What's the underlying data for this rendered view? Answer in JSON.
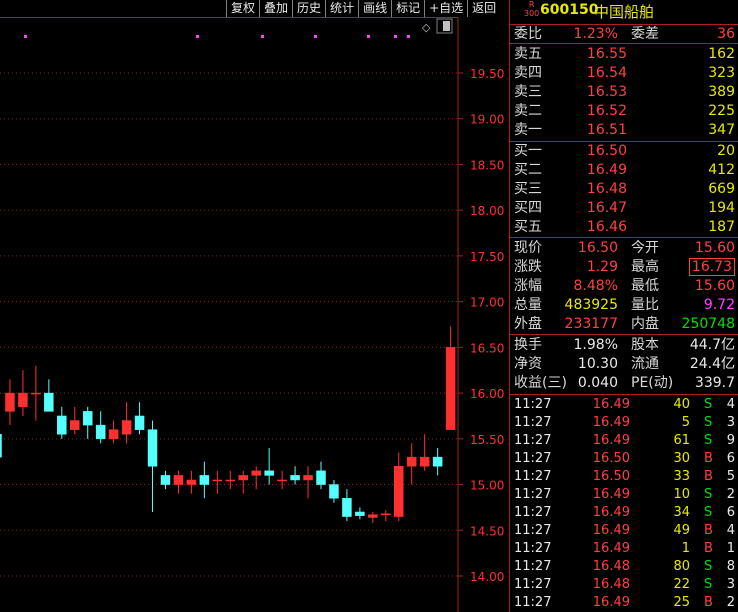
{
  "toolbar": [
    "复权",
    "叠加",
    "历史",
    "统计",
    "画线",
    "标记",
    "+自选",
    "返回"
  ],
  "chart": {
    "ylim": [
      13.9,
      19.8
    ],
    "y_ticks": [
      "19.50",
      "19.00",
      "18.50",
      "18.00",
      "17.50",
      "17.00",
      "16.50",
      "16.00",
      "15.50",
      "15.00",
      "14.50",
      "14.00"
    ],
    "y_tick_values": [
      19.5,
      19.0,
      18.5,
      18.0,
      17.5,
      17.0,
      16.5,
      16.0,
      15.5,
      15.0,
      14.5,
      14.0
    ],
    "candles": [
      {
        "o": 15.55,
        "h": 15.75,
        "l": 15.3,
        "c": 15.3
      },
      {
        "o": 15.8,
        "h": 16.15,
        "l": 15.65,
        "c": 16.0
      },
      {
        "o": 15.85,
        "h": 16.25,
        "l": 15.75,
        "c": 16.0
      },
      {
        "o": 16.0,
        "h": 16.3,
        "l": 15.7,
        "c": 16.0
      },
      {
        "o": 16.0,
        "h": 16.15,
        "l": 15.8,
        "c": 15.8
      },
      {
        "o": 15.75,
        "h": 15.85,
        "l": 15.5,
        "c": 15.55
      },
      {
        "o": 15.6,
        "h": 15.85,
        "l": 15.55,
        "c": 15.7
      },
      {
        "o": 15.8,
        "h": 15.85,
        "l": 15.5,
        "c": 15.65
      },
      {
        "o": 15.65,
        "h": 15.8,
        "l": 15.45,
        "c": 15.5
      },
      {
        "o": 15.5,
        "h": 15.7,
        "l": 15.45,
        "c": 15.6
      },
      {
        "o": 15.55,
        "h": 15.9,
        "l": 15.45,
        "c": 15.7
      },
      {
        "o": 15.75,
        "h": 15.9,
        "l": 15.55,
        "c": 15.6
      },
      {
        "o": 15.6,
        "h": 15.7,
        "l": 14.7,
        "c": 15.2
      },
      {
        "o": 15.1,
        "h": 15.15,
        "l": 14.95,
        "c": 15.0
      },
      {
        "o": 15.0,
        "h": 15.15,
        "l": 14.9,
        "c": 15.1
      },
      {
        "o": 15.0,
        "h": 15.15,
        "l": 14.9,
        "c": 15.05
      },
      {
        "o": 15.1,
        "h": 15.25,
        "l": 14.85,
        "c": 15.0
      },
      {
        "o": 15.05,
        "h": 15.15,
        "l": 14.9,
        "c": 15.05
      },
      {
        "o": 15.05,
        "h": 15.15,
        "l": 14.95,
        "c": 15.05
      },
      {
        "o": 15.05,
        "h": 15.15,
        "l": 14.9,
        "c": 15.1
      },
      {
        "o": 15.1,
        "h": 15.2,
        "l": 14.95,
        "c": 15.15
      },
      {
        "o": 15.15,
        "h": 15.4,
        "l": 15.0,
        "c": 15.1
      },
      {
        "o": 15.05,
        "h": 15.15,
        "l": 14.95,
        "c": 15.05
      },
      {
        "o": 15.1,
        "h": 15.2,
        "l": 15.0,
        "c": 15.05
      },
      {
        "o": 15.05,
        "h": 15.2,
        "l": 14.85,
        "c": 15.1
      },
      {
        "o": 15.15,
        "h": 15.25,
        "l": 14.95,
        "c": 15.0
      },
      {
        "o": 15.0,
        "h": 15.05,
        "l": 14.8,
        "c": 14.85
      },
      {
        "o": 14.85,
        "h": 14.95,
        "l": 14.6,
        "c": 14.65
      },
      {
        "o": 14.7,
        "h": 14.75,
        "l": 14.62,
        "c": 14.66
      },
      {
        "o": 14.64,
        "h": 14.7,
        "l": 14.58,
        "c": 14.67
      },
      {
        "o": 14.68,
        "h": 14.72,
        "l": 14.6,
        "c": 14.68
      },
      {
        "o": 14.65,
        "h": 15.35,
        "l": 14.6,
        "c": 15.2
      },
      {
        "o": 15.2,
        "h": 15.45,
        "l": 15.0,
        "c": 15.3
      },
      {
        "o": 15.2,
        "h": 15.55,
        "l": 15.15,
        "c": 15.3
      },
      {
        "o": 15.3,
        "h": 15.4,
        "l": 15.1,
        "c": 15.2
      },
      {
        "o": 15.6,
        "h": 16.73,
        "l": 15.6,
        "c": 16.5
      }
    ]
  },
  "stock": {
    "code": "600150",
    "name": "中国船舶",
    "badge_top": "R",
    "badge_bottom": "300"
  },
  "weibi": {
    "label": "委比",
    "value": "1.23%",
    "label2": "委差",
    "value2": "36"
  },
  "sell": [
    {
      "label": "卖五",
      "price": "16.55",
      "vol": "162"
    },
    {
      "label": "卖四",
      "price": "16.54",
      "vol": "323"
    },
    {
      "label": "卖三",
      "price": "16.53",
      "vol": "389"
    },
    {
      "label": "卖二",
      "price": "16.52",
      "vol": "225"
    },
    {
      "label": "卖一",
      "price": "16.51",
      "vol": "347"
    }
  ],
  "buy": [
    {
      "label": "买一",
      "price": "16.50",
      "vol": "20"
    },
    {
      "label": "买二",
      "price": "16.49",
      "vol": "412"
    },
    {
      "label": "买三",
      "price": "16.48",
      "vol": "669"
    },
    {
      "label": "买四",
      "price": "16.47",
      "vol": "194"
    },
    {
      "label": "买五",
      "price": "16.46",
      "vol": "187"
    }
  ],
  "quote": [
    {
      "l1": "现价",
      "v1": "16.50",
      "c1": "red",
      "l2": "今开",
      "v2": "15.60",
      "c2": "red"
    },
    {
      "l1": "涨跌",
      "v1": "1.29",
      "c1": "red",
      "l2": "最高",
      "v2": "16.73",
      "c2": "red"
    },
    {
      "l1": "涨幅",
      "v1": "8.48%",
      "c1": "red",
      "l2": "最低",
      "v2": "15.60",
      "c2": "red"
    },
    {
      "l1": "总量",
      "v1": "483925",
      "c1": "yel",
      "l2": "量比",
      "v2": "9.72",
      "c2": "mag"
    },
    {
      "l1": "外盘",
      "v1": "233177",
      "c1": "red",
      "l2": "内盘",
      "v2": "250748",
      "c2": "grn"
    }
  ],
  "finance": [
    {
      "l1": "换手",
      "v1": "1.98%",
      "l2": "股本",
      "v2": "44.7亿"
    },
    {
      "l1": "净资",
      "v1": "10.30",
      "l2": "流通",
      "v2": "24.4亿"
    },
    {
      "l1": "收益(三)",
      "v1": "0.040",
      "l2": "PE(动)",
      "v2": "339.7"
    }
  ],
  "ticks": [
    {
      "t": "11:27",
      "p": "16.49",
      "v": "40",
      "d": "S",
      "n": "4"
    },
    {
      "t": "11:27",
      "p": "16.49",
      "v": "5",
      "d": "S",
      "n": "3"
    },
    {
      "t": "11:27",
      "p": "16.49",
      "v": "61",
      "d": "S",
      "n": "9"
    },
    {
      "t": "11:27",
      "p": "16.50",
      "v": "30",
      "d": "B",
      "n": "6"
    },
    {
      "t": "11:27",
      "p": "16.50",
      "v": "33",
      "d": "B",
      "n": "5"
    },
    {
      "t": "11:27",
      "p": "16.49",
      "v": "10",
      "d": "S",
      "n": "2"
    },
    {
      "t": "11:27",
      "p": "16.49",
      "v": "34",
      "d": "S",
      "n": "6"
    },
    {
      "t": "11:27",
      "p": "16.49",
      "v": "49",
      "d": "B",
      "n": "4"
    },
    {
      "t": "11:27",
      "p": "16.49",
      "v": "1",
      "d": "B",
      "n": "1"
    },
    {
      "t": "11:27",
      "p": "16.48",
      "v": "80",
      "d": "S",
      "n": "8"
    },
    {
      "t": "11:27",
      "p": "16.48",
      "v": "22",
      "d": "S",
      "n": "3"
    },
    {
      "t": "11:27",
      "p": "16.49",
      "v": "25",
      "d": "B",
      "n": "2"
    }
  ],
  "colors": {
    "up": "#ff3030",
    "down": "#54ffff",
    "grid": "#8b1a1a",
    "border": "#aa1f1f",
    "marker": "#ff40ff"
  }
}
